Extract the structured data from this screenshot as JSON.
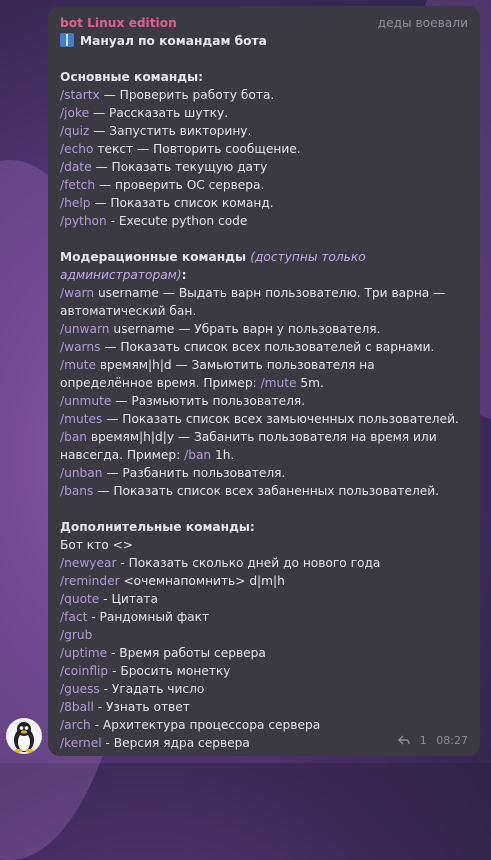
{
  "message": {
    "sender": "bot Linux edition",
    "tag": "деды воевали",
    "title": "Мануал по командам бота",
    "sections": [
      {
        "heading": "Основные команды:",
        "note": "",
        "lines": [
          {
            "cmd": "/startx",
            "arg": "",
            "text": " — Проверить работу бота."
          },
          {
            "cmd": "/joke",
            "arg": "",
            "text": " — Рассказать шутку."
          },
          {
            "cmd": "/quiz",
            "arg": "",
            "text": " — Запустить викторину."
          },
          {
            "cmd": "/echo",
            "arg": " текст",
            "text": " — Повторить сообщение."
          },
          {
            "cmd": "/date",
            "arg": "",
            "text": " — Показать текущую дату"
          },
          {
            "cmd": "/fetch",
            "arg": "",
            "text": " — проверить ОС сервера."
          },
          {
            "cmd": "/help",
            "arg": "",
            "text": " — Показать список команд."
          },
          {
            "cmd": "/python",
            "arg": "",
            "text": " - Execute python code"
          }
        ]
      },
      {
        "heading": "Модерационные команды",
        "note": "(доступны только администраторам)",
        "lines": [
          {
            "cmd": "/warn",
            "arg": " username",
            "text": " — Выдать варн пользователю. Три варна — автоматический бан."
          },
          {
            "cmd": "/unwarn",
            "arg": " username",
            "text": " — Убрать варн у пользователя."
          },
          {
            "cmd": "/warns",
            "arg": "",
            "text": " — Показать список всех пользователей с варнами."
          },
          {
            "cmd": "/mute",
            "arg": " времям|h|d",
            "text": " — Замьютить пользователя на определённое время. Пример: ",
            "cmd2": "/mute",
            "tail": " 5m."
          },
          {
            "cmd": "/unmute",
            "arg": "",
            "text": " — Размьютить пользователя."
          },
          {
            "cmd": "/mutes",
            "arg": "",
            "text": " — Показать список всех замьюченных пользователей."
          },
          {
            "cmd": "/ban",
            "arg": " времям|h|d|y",
            "text": " — Забанить пользователя на время или навсегда. Пример: ",
            "cmd2": "/ban",
            "tail": " 1h."
          },
          {
            "cmd": "/unban",
            "arg": "",
            "text": " — Разбанить пользователя."
          },
          {
            "cmd": "/bans",
            "arg": "",
            "text": " — Показать список всех забаненных пользователей."
          }
        ]
      },
      {
        "heading": "Дополнительные команды:",
        "note": "",
        "lines": [
          {
            "cmd": "",
            "arg": "",
            "text": "Бот кто <>"
          },
          {
            "cmd": "/newyear",
            "arg": "",
            "text": " - Показать сколько дней до нового года"
          },
          {
            "cmd": "/reminder",
            "arg": "",
            "text": " <очемнапомнить> d|m|h"
          },
          {
            "cmd": "/quote",
            "arg": "",
            "text": " - Цитата"
          },
          {
            "cmd": "/fact",
            "arg": "",
            "text": " - Рандомный факт"
          },
          {
            "cmd": "/grub",
            "arg": "",
            "text": ""
          },
          {
            "cmd": "/uptime",
            "arg": "",
            "text": " - Время работы сервера"
          },
          {
            "cmd": "/coinflip",
            "arg": "",
            "text": " - Бросить монетку"
          },
          {
            "cmd": "/guess",
            "arg": "",
            "text": " - Угадать число"
          },
          {
            "cmd": "/8ball",
            "arg": "",
            "text": " - Узнать ответ"
          },
          {
            "cmd": "/arch",
            "arg": "",
            "text": " - Архитектура процессора сервера"
          },
          {
            "cmd": "/kernel",
            "arg": "",
            "text": " - Версия ядра сервера"
          }
        ]
      }
    ],
    "reply_count": "1",
    "time": "08:27"
  },
  "colors": {
    "sender": "#e05d8d",
    "command": "#b19ad8",
    "bubble": "#3b3a42"
  },
  "icons": {
    "title_icon": "book-icon",
    "reply_icon": "reply-arrow-icon",
    "avatar": "tux-penguin-avatar"
  }
}
